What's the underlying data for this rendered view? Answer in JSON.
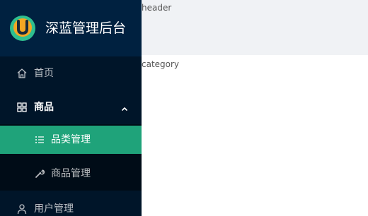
{
  "brand": {
    "title": "深蓝管理后台",
    "logo_letter": "U",
    "logo_colors": {
      "outer": "#2fbf8f",
      "inner": "#f5a623",
      "letter": "#1a2a3a"
    }
  },
  "sidebar": {
    "colors": {
      "background": "#001529",
      "submenu_background": "#000c17",
      "active": "#1fa37a"
    },
    "items": [
      {
        "label": "首页",
        "icon": "home-icon"
      },
      {
        "label": "商品",
        "icon": "appstore-icon",
        "expanded": true,
        "expand_icon": "chevron-up-icon",
        "children": [
          {
            "label": "品类管理",
            "icon": "bars-icon",
            "active": true
          },
          {
            "label": "商品管理",
            "icon": "tool-icon"
          }
        ]
      },
      {
        "label": "用户管理",
        "icon": "user-icon"
      }
    ]
  },
  "header": {
    "text": "header"
  },
  "content": {
    "text": "category"
  }
}
